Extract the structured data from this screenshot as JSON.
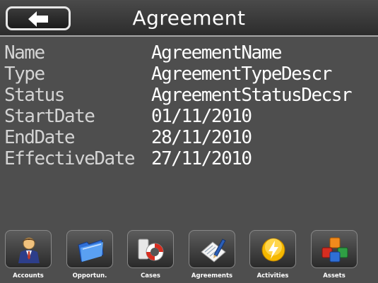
{
  "header": {
    "title": "Agreement",
    "back_icon": "back-arrow-icon"
  },
  "fields": [
    {
      "label": "Name",
      "value": "AgreementName"
    },
    {
      "label": "Type",
      "value": "AgreementTypeDescr"
    },
    {
      "label": "Status",
      "value": "AgreementStatusDecsr"
    },
    {
      "label": "StartDate",
      "value": "01/11/2010"
    },
    {
      "label": "EndDate",
      "value": "28/11/2010"
    },
    {
      "label": "EffectiveDate",
      "value": "27/11/2010"
    }
  ],
  "tabs": [
    {
      "label": "Accounts",
      "icon": "person-icon"
    },
    {
      "label": "Opportun.",
      "icon": "folder-icon"
    },
    {
      "label": "Cases",
      "icon": "lifebuoy-icon"
    },
    {
      "label": "Agreements",
      "icon": "document-pen-icon"
    },
    {
      "label": "Activities",
      "icon": "lightning-icon"
    },
    {
      "label": "Assets",
      "icon": "cubes-icon"
    }
  ]
}
